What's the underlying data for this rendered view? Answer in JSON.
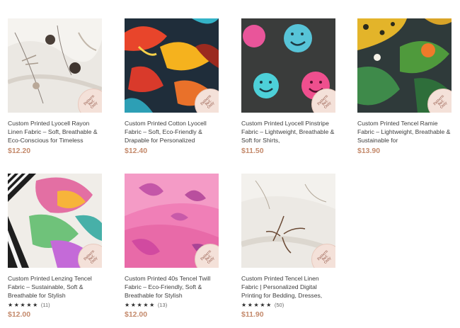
{
  "colors": {
    "price": "#c48a6c",
    "stamp_bg": "#f4e1d9"
  },
  "stamp_label": "Pattern Ref. Only",
  "products": [
    {
      "title": "Custom Printed Lyocell Rayon Linen Fabric – Soft, Breathable & Eco-Conscious for Timeless",
      "price": "$12.20",
      "stars": "",
      "reviews": ""
    },
    {
      "title": "Custom Printed Cotton Lyocell Fabric – Soft, Eco-Friendly & Drapable for Personalized",
      "price": "$12.40",
      "stars": "",
      "reviews": ""
    },
    {
      "title": "Custom Printed Lyocell Pinstripe Fabric – Lightweight, Breathable & Soft for Shirts,",
      "price": "$11.50",
      "stars": "",
      "reviews": ""
    },
    {
      "title": "Custom Printed Tencel Ramie Fabric – Lightweight, Breathable & Sustainable for",
      "price": "$13.90",
      "stars": "",
      "reviews": ""
    },
    {
      "title": "Custom Printed Lenzing Tencel Fabric – Sustainable, Soft & Breathable for Stylish",
      "price": "$12.00",
      "stars": "★★★★★",
      "reviews": "(11)"
    },
    {
      "title": "Custom Printed 40s Tencel Twill Fabric – Eco-Friendly, Soft & Breathable for Stylish",
      "price": "$12.00",
      "stars": "★★★★★",
      "reviews": "(13)"
    },
    {
      "title": "Custom Printed Tencel Linen Fabric | Personalized Digital Printing for Bedding, Dresses,",
      "price": "$11.90",
      "stars": "★★★★★",
      "reviews": "(50)"
    }
  ]
}
